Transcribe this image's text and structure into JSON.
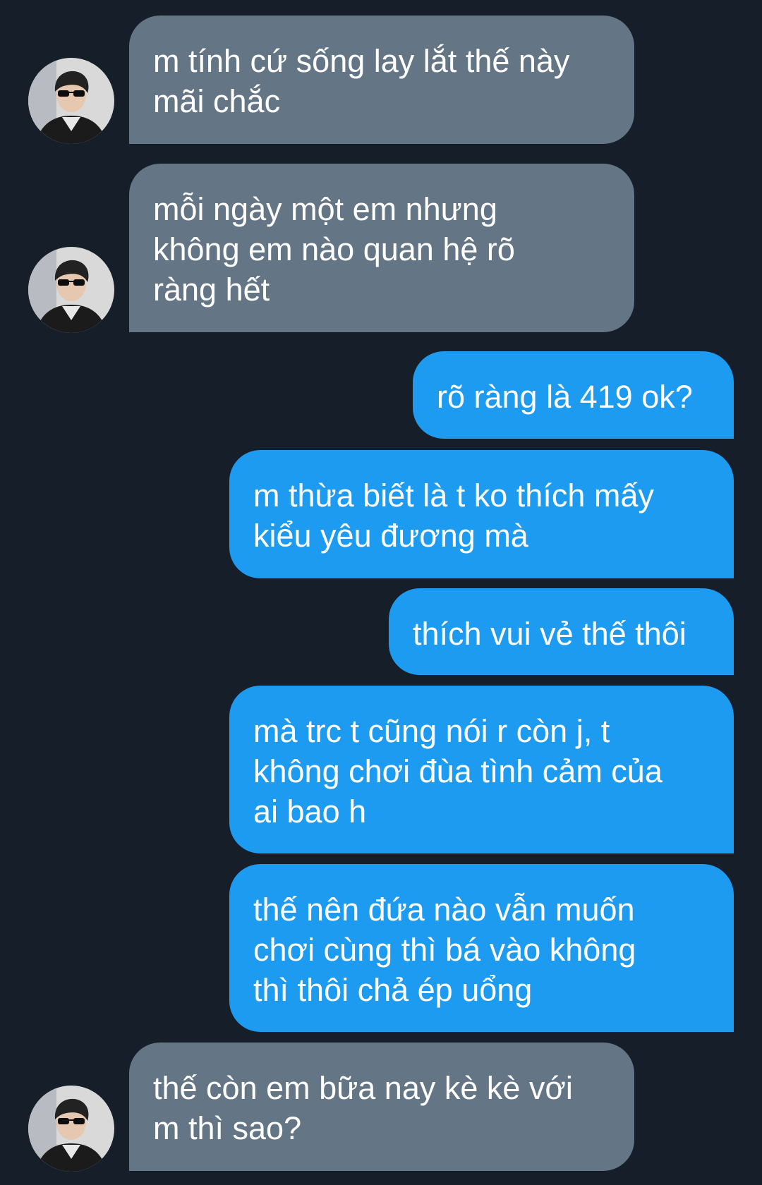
{
  "thread": {
    "messages": [
      {
        "side": "in",
        "text": "m tính cứ sống lay lắt thế này\nmãi chắc"
      },
      {
        "side": "in",
        "text": "mỗi ngày một em nhưng\nkhông em nào quan hệ rõ\nràng hết"
      },
      {
        "side": "out",
        "text": "rõ ràng là 419 ok?"
      },
      {
        "side": "out",
        "text": "m thừa biết là t ko thích mấy\nkiểu yêu đương mà"
      },
      {
        "side": "out",
        "text": "thích vui vẻ thế thôi"
      },
      {
        "side": "out",
        "text": "mà trc t cũng nói r còn j, t\nkhông chơi đùa tình cảm của\nai bao h"
      },
      {
        "side": "out",
        "text": "thế nên đứa nào vẫn muốn\nchơi cùng thì bá vào không\nthì thôi chả ép uổng"
      },
      {
        "side": "in",
        "text": "thế còn em bữa nay kè kè với\nm thì sao?"
      }
    ]
  },
  "colors": {
    "background": "#151e29",
    "incoming_bubble": "#647585",
    "outgoing_bubble": "#1d9bf0",
    "text": "#ffffff"
  },
  "icons": {
    "contact_avatar": "avatar-photo-man-sunglasses"
  }
}
